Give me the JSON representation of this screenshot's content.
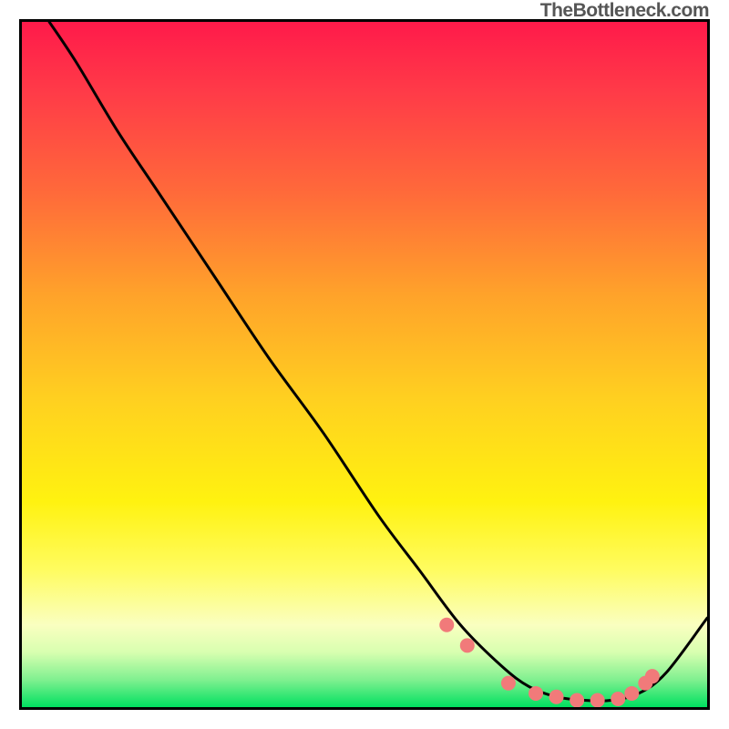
{
  "attribution": "TheBottleneck.com",
  "chart_data": {
    "type": "line",
    "title": "",
    "xlabel": "",
    "ylabel": "",
    "xlim": [
      0,
      100
    ],
    "ylim": [
      0,
      100
    ],
    "background": "gradient-heatmap-vertical",
    "gradient_stops": [
      {
        "pos": 0,
        "color": "#ff1a4a"
      },
      {
        "pos": 25,
        "color": "#ff6a3a"
      },
      {
        "pos": 55,
        "color": "#ffd020"
      },
      {
        "pos": 80,
        "color": "#fffc60"
      },
      {
        "pos": 100,
        "color": "#00e060"
      }
    ],
    "series": [
      {
        "name": "bottleneck-curve",
        "type": "line",
        "color": "#000000",
        "x": [
          4,
          8,
          14,
          20,
          28,
          36,
          44,
          52,
          58,
          64,
          70,
          74,
          78,
          82,
          86,
          90,
          94,
          100
        ],
        "y": [
          100,
          94,
          84,
          75,
          63,
          51,
          40,
          28,
          20,
          12,
          6,
          3,
          1.5,
          1,
          1,
          2,
          5,
          13
        ]
      },
      {
        "name": "marker-dots",
        "type": "scatter",
        "color": "#f17a7a",
        "x": [
          62,
          65,
          71,
          75,
          78,
          81,
          84,
          87,
          89,
          91,
          92
        ],
        "y": [
          12,
          9,
          3.5,
          2,
          1.5,
          1,
          1,
          1.2,
          2,
          3.5,
          4.5
        ]
      }
    ]
  }
}
